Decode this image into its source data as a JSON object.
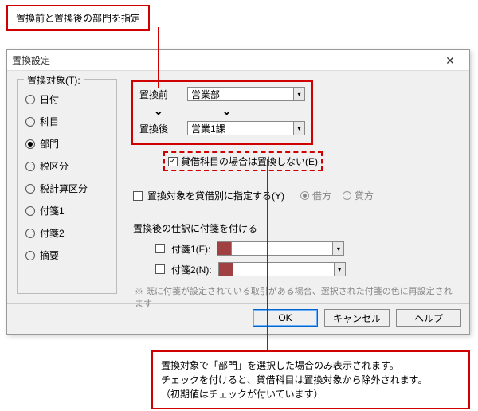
{
  "annotation": {
    "top": "置換前と置換後の部門を指定",
    "bottom_l1": "置換対象で「部門」を選択した場合のみ表示されます。",
    "bottom_l2": "チェックを付けると、貸借科目は置換対象から除外されます。",
    "bottom_l3": "（初期値はチェックが付いています）"
  },
  "dialog": {
    "title": "置換設定",
    "group_label": "置換対象(T):",
    "targets": [
      {
        "label": "日付",
        "checked": false
      },
      {
        "label": "科目",
        "checked": false
      },
      {
        "label": "部門",
        "checked": true
      },
      {
        "label": "税区分",
        "checked": false
      },
      {
        "label": "税計算区分",
        "checked": false
      },
      {
        "label": "付箋1",
        "checked": false
      },
      {
        "label": "付箋2",
        "checked": false
      },
      {
        "label": "摘要",
        "checked": false
      }
    ],
    "before_label": "置換前",
    "before_value": "営業部",
    "after_label": "置換後",
    "after_value": "営業1課",
    "bs_exclude": "貸借科目の場合は置換しない(E)",
    "specby_label": "置換対象を貸借別に指定する(Y)",
    "specby_debit": "借方",
    "specby_credit": "貸方",
    "tag_section": "置換後の仕訳に付箋を付ける",
    "tag1": "付箋1(F):",
    "tag2": "付箋2(N):",
    "note": "※ 既に付箋が設定されている取引がある場合、選択された付箋の色に再設定されます",
    "buttons": {
      "ok": "OK",
      "cancel": "キャンセル",
      "help": "ヘルプ"
    }
  }
}
